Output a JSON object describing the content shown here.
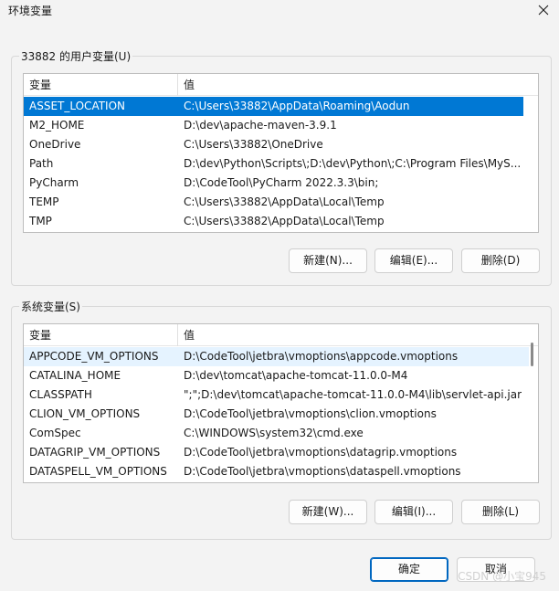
{
  "window": {
    "title": "环境变量"
  },
  "user_vars": {
    "group_label": "33882 的用户变量(U)",
    "columns": {
      "name": "变量",
      "value": "值"
    },
    "rows": [
      {
        "name": "ASSET_LOCATION",
        "value": "C:\\Users\\33882\\AppData\\Roaming\\Aodun"
      },
      {
        "name": "M2_HOME",
        "value": "D:\\dev\\apache-maven-3.9.1"
      },
      {
        "name": "OneDrive",
        "value": "C:\\Users\\33882\\OneDrive"
      },
      {
        "name": "Path",
        "value": "D:\\dev\\Python\\Scripts\\;D:\\dev\\Python\\;C:\\Program Files\\MyS..."
      },
      {
        "name": "PyCharm",
        "value": "D:\\CodeTool\\PyCharm 2022.3.3\\bin;"
      },
      {
        "name": "TEMP",
        "value": "C:\\Users\\33882\\AppData\\Local\\Temp"
      },
      {
        "name": "TMP",
        "value": "C:\\Users\\33882\\AppData\\Local\\Temp"
      }
    ],
    "buttons": {
      "new": "新建(N)...",
      "edit": "编辑(E)...",
      "delete": "删除(D)"
    }
  },
  "system_vars": {
    "group_label": "系统变量(S)",
    "columns": {
      "name": "变量",
      "value": "值"
    },
    "rows": [
      {
        "name": "APPCODE_VM_OPTIONS",
        "value": "D:\\CodeTool\\jetbra\\vmoptions\\appcode.vmoptions"
      },
      {
        "name": "CATALINA_HOME",
        "value": "D:\\dev\\tomcat\\apache-tomcat-11.0.0-M4"
      },
      {
        "name": "CLASSPATH",
        "value": "\";\";D:\\dev\\tomcat\\apache-tomcat-11.0.0-M4\\lib\\servlet-api.jar..."
      },
      {
        "name": "CLION_VM_OPTIONS",
        "value": "D:\\CodeTool\\jetbra\\vmoptions\\clion.vmoptions"
      },
      {
        "name": "ComSpec",
        "value": "C:\\WINDOWS\\system32\\cmd.exe"
      },
      {
        "name": "DATAGRIP_VM_OPTIONS",
        "value": "D:\\CodeTool\\jetbra\\vmoptions\\datagrip.vmoptions"
      },
      {
        "name": "DATASPELL_VM_OPTIONS",
        "value": "D:\\CodeTool\\jetbra\\vmoptions\\dataspell.vmoptions"
      }
    ],
    "buttons": {
      "new": "新建(W)...",
      "edit": "编辑(I)...",
      "delete": "删除(L)"
    }
  },
  "footer": {
    "ok": "确定",
    "cancel": "取消",
    "watermark": "CSDN @小宝945"
  },
  "colors": {
    "selection": "#0078d4",
    "background": "#f3f3f3"
  }
}
